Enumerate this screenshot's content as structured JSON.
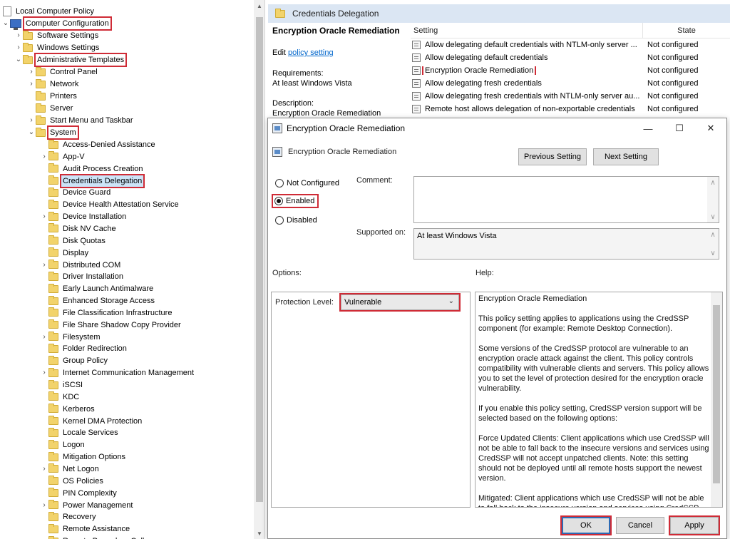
{
  "tree": {
    "root_label": "Local Computer Policy",
    "computer_config": "Computer Configuration",
    "software_settings": "Software Settings",
    "windows_settings": "Windows Settings",
    "admin_templates": "Administrative Templates",
    "control_panel": "Control Panel",
    "network": "Network",
    "printers": "Printers",
    "server": "Server",
    "start_menu": "Start Menu and Taskbar",
    "system": "System",
    "system_items": [
      "Access-Denied Assistance",
      "App-V",
      "Audit Process Creation",
      "Credentials Delegation",
      "Device Guard",
      "Device Health Attestation Service",
      "Device Installation",
      "Disk NV Cache",
      "Disk Quotas",
      "Display",
      "Distributed COM",
      "Driver Installation",
      "Early Launch Antimalware",
      "Enhanced Storage Access",
      "File Classification Infrastructure",
      "File Share Shadow Copy Provider",
      "Filesystem",
      "Folder Redirection",
      "Group Policy",
      "Internet Communication Management",
      "iSCSI",
      "KDC",
      "Kerberos",
      "Kernel DMA Protection",
      "Locale Services",
      "Logon",
      "Mitigation Options",
      "Net Logon",
      "OS Policies",
      "PIN Complexity",
      "Power Management",
      "Recovery",
      "Remote Assistance",
      "Remote Procedure Call"
    ]
  },
  "background": {
    "folder_title": "Credentials Delegation",
    "selected_heading": "Encryption Oracle Remediation",
    "edit_prefix": "Edit ",
    "edit_link": "policy setting",
    "requirements_label": "Requirements:",
    "requirements_value": "At least Windows Vista",
    "description_label": "Description:",
    "description_value": "Encryption Oracle Remediation",
    "col_setting": "Setting",
    "col_state": "State",
    "rows": [
      {
        "name": "Allow delegating default credentials with NTLM-only server ...",
        "state": "Not configured"
      },
      {
        "name": "Allow delegating default credentials",
        "state": "Not configured"
      },
      {
        "name": "Encryption Oracle Remediation",
        "state": "Not configured"
      },
      {
        "name": "Allow delegating fresh credentials",
        "state": "Not configured"
      },
      {
        "name": "Allow delegating fresh credentials with NTLM-only server au...",
        "state": "Not configured"
      },
      {
        "name": "Remote host allows delegation of non-exportable credentials",
        "state": "Not configured"
      }
    ]
  },
  "dialog": {
    "title": "Encryption Oracle Remediation",
    "minimize": "—",
    "maximize": "☐",
    "close": "✕",
    "setting_name": "Encryption Oracle Remediation",
    "prev_button": "Previous Setting",
    "next_button": "Next Setting",
    "radio_not_configured": "Not Configured",
    "radio_enabled": "Enabled",
    "radio_disabled": "Disabled",
    "selected_radio": "Enabled",
    "comment_label": "Comment:",
    "supported_label": "Supported on:",
    "supported_value": "At least Windows Vista",
    "options_label": "Options:",
    "help_label": "Help:",
    "protection_label": "Protection Level:",
    "protection_value": "Vulnerable",
    "help_paragraphs": [
      "Encryption Oracle Remediation",
      "This policy setting applies to applications using the CredSSP component (for example: Remote Desktop Connection).",
      "Some versions of the CredSSP protocol are vulnerable to an encryption oracle attack against the client.  This policy controls compatibility with vulnerable clients and servers.  This policy allows you to set the level of protection desired for the encryption oracle vulnerability.",
      "If you enable this policy setting, CredSSP version support will be selected based on the following options:",
      "Force Updated Clients: Client applications which use CredSSP will not be able to fall back to the insecure versions and services using CredSSP will not accept unpatched clients. Note: this setting should not be deployed until all remote hosts support the newest version.",
      "Mitigated: Client applications which use CredSSP will not be able to fall back to the insecure version and services using CredSSP will accept unpatched clients."
    ],
    "ok_button": "OK",
    "cancel_button": "Cancel",
    "apply_button": "Apply"
  },
  "colors": {
    "highlight_border": "#cf2b36",
    "selection_bg": "#cce4f7",
    "title_band": "#dbe6f3",
    "link": "#0066cc"
  }
}
